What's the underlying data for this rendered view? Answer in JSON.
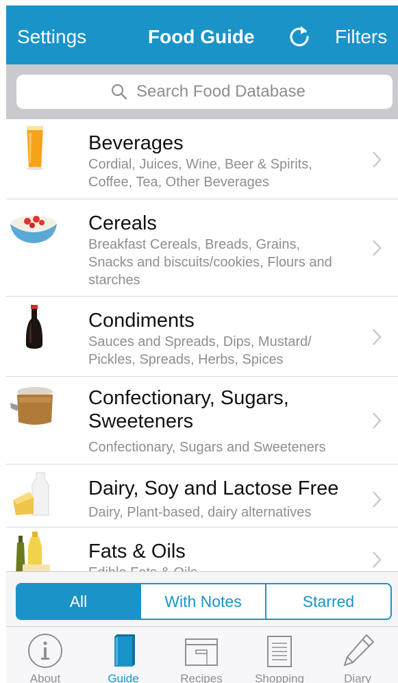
{
  "colors": {
    "accent": "#1a93c9",
    "text_secondary": "#8e8e93",
    "search_bar_bg": "#c9c9ce"
  },
  "navbar": {
    "left_label": "Settings",
    "title": "Food Guide",
    "refresh_icon": "refresh-icon",
    "right_label": "Filters"
  },
  "search": {
    "placeholder": "Search Food Database",
    "icon": "search-icon"
  },
  "categories": [
    {
      "title": "Beverages",
      "subtitle": "Cordial, Juices, Wine, Beer & Spirits,\nCoffee, Tea, Other Beverages",
      "icon": "orange-juice-icon"
    },
    {
      "title": "Cereals",
      "subtitle": "Breakfast Cereals, Breads, Grains,\nSnacks and biscuits/cookies, Flours and\nstarches",
      "icon": "cereal-bowl-icon"
    },
    {
      "title": "Condiments",
      "subtitle": "Sauces and Spreads, Dips, Mustard/\nPickles, Spreads, Herbs, Spices",
      "icon": "soy-sauce-bottle-icon"
    },
    {
      "title": "Confectionary, Sugars,\nSweeteners",
      "subtitle": "Confectionary, Sugars and Sweeteners",
      "icon": "sugar-jar-icon"
    },
    {
      "title": "Dairy, Soy and Lactose Free",
      "subtitle": "Dairy, Plant-based, dairy alternatives",
      "icon": "milk-cheese-icon"
    },
    {
      "title": "Fats & Oils",
      "subtitle": "Edible Fats & Oils",
      "icon": "oil-bottles-icon"
    }
  ],
  "filter_segments": {
    "all": "All",
    "with_notes": "With Notes",
    "starred": "Starred",
    "selected": "All"
  },
  "tabbar": {
    "active": "Guide",
    "items": [
      {
        "label": "About",
        "icon": "info-icon"
      },
      {
        "label": "Guide",
        "icon": "book-icon"
      },
      {
        "label": "Recipes",
        "icon": "recipe-box-icon"
      },
      {
        "label": "Shopping",
        "icon": "notepad-icon"
      },
      {
        "label": "Diary",
        "icon": "pencil-icon"
      }
    ]
  }
}
